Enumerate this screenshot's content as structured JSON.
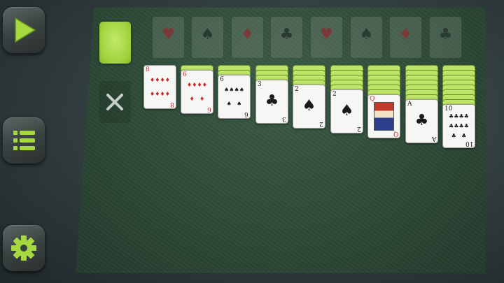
{
  "sidebar": {
    "buttons": [
      {
        "name": "play-button",
        "icon": "play-icon"
      },
      {
        "name": "menu-button",
        "icon": "menu-icon"
      },
      {
        "name": "settings-button",
        "icon": "gear-icon"
      }
    ],
    "accent": "#9fd33c"
  },
  "stock": {
    "icon": "card-back"
  },
  "waste": {
    "icon": "close-icon"
  },
  "foundations": [
    {
      "suit": "♥",
      "color": "red"
    },
    {
      "suit": "♠",
      "color": "black"
    },
    {
      "suit": "♦",
      "color": "red"
    },
    {
      "suit": "♣",
      "color": "black"
    },
    {
      "suit": "♥",
      "color": "red"
    },
    {
      "suit": "♠",
      "color": "black"
    },
    {
      "suit": "♦",
      "color": "red"
    },
    {
      "suit": "♣",
      "color": "black"
    }
  ],
  "tableau": [
    {
      "facedown": 0,
      "rank": "8",
      "suit": "♦",
      "color": "red"
    },
    {
      "facedown": 1,
      "rank": "6",
      "suit": "♦",
      "color": "red"
    },
    {
      "facedown": 2,
      "rank": "6",
      "suit": "♠",
      "color": "black"
    },
    {
      "facedown": 3,
      "rank": "3",
      "suit": "♣",
      "color": "black"
    },
    {
      "facedown": 4,
      "rank": "2",
      "suit": "♠",
      "color": "black"
    },
    {
      "facedown": 5,
      "rank": "2",
      "suit": "♠",
      "color": "black"
    },
    {
      "facedown": 6,
      "rank": "Q",
      "suit": "♥",
      "color": "red"
    },
    {
      "facedown": 7,
      "rank": "A",
      "suit": "♣",
      "color": "black"
    },
    {
      "facedown": 8,
      "rank": "10",
      "suit": "♣",
      "color": "black"
    }
  ]
}
